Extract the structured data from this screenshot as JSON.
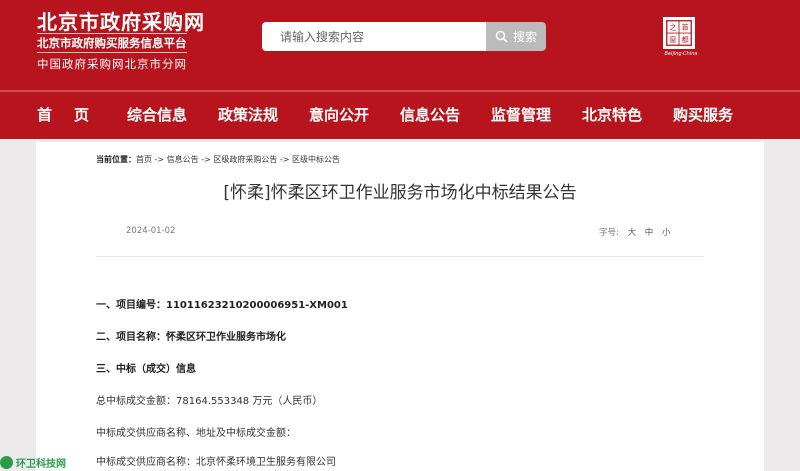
{
  "header": {
    "site_title": "北京市政府采购网",
    "subtitle": "北京市政府购买服务信息平台",
    "branch": "中国政府采购网北京市分网",
    "emblem_caption": "Beijing·China",
    "emblem_chars": [
      "之",
      "首",
      "都",
      "窗"
    ]
  },
  "search": {
    "placeholder": "请输入搜索内容",
    "button_label": "搜索"
  },
  "nav": {
    "items": [
      "首页",
      "综合信息",
      "政策法规",
      "意向公开",
      "信息公告",
      "监督管理",
      "北京特色",
      "购买服务"
    ]
  },
  "breadcrumb": {
    "label": "当前位置：",
    "path": "首页 -> 信息公告 -> 区级政府采购公告 -> 区级中标公告"
  },
  "article": {
    "title": "[怀柔]怀柔区环卫作业服务市场化中标结果公告",
    "date": "2024-01-02",
    "font_size_label": "字号:",
    "font_size_options": [
      "大",
      "中",
      "小"
    ],
    "paragraphs": [
      "一、项目编号：11011623210200006951-XM001",
      "二、项目名称：怀柔区环卫作业服务市场化",
      "三、中标（成交）信息",
      "总中标成交金额：78164.553348 万元（人民币）",
      "中标成交供应商名称、地址及中标成交金额：",
      "中标成交供应商名称：北京怀柔环境卫生服务有限公司"
    ]
  },
  "watermark": {
    "text": "环卫科技网"
  },
  "colors": {
    "brand_red": "#b8141d",
    "search_button": "#bbbbbb",
    "page_background": "#eceaea"
  }
}
